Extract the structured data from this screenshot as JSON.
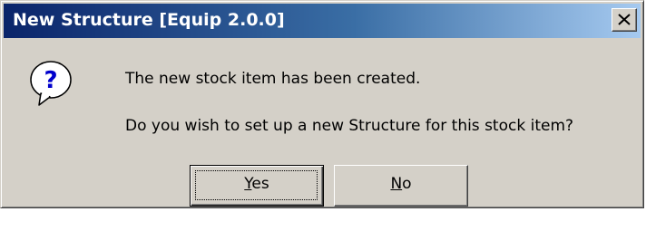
{
  "window": {
    "title": "New Structure  [Equip 2.0.0]"
  },
  "icon": {
    "name": "question-icon",
    "glyph": "?"
  },
  "message": {
    "line1": "The new stock item has been created.",
    "line2": "Do you wish to set up a new Structure for this stock item?"
  },
  "buttons": {
    "yes": {
      "mnemonic": "Y",
      "rest": "es"
    },
    "no": {
      "mnemonic": "N",
      "rest": "o"
    }
  },
  "colors": {
    "titlebar_start": "#0a246a",
    "titlebar_end": "#a6caf0",
    "dialog_bg": "#d4d0c8"
  }
}
